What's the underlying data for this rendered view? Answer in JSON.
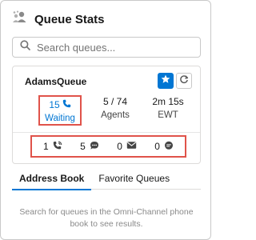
{
  "header": {
    "title": "Queue Stats",
    "icon": "people-group-icon"
  },
  "search": {
    "placeholder": "Search queues..."
  },
  "queue": {
    "name": "AdamsQueue",
    "stats": [
      {
        "value": "15",
        "label": "Waiting",
        "icon": "phone-icon"
      },
      {
        "value": "5 / 74",
        "label": "Agents"
      },
      {
        "value": "2m 15s",
        "label": "EWT"
      }
    ],
    "channels": [
      {
        "count": "1",
        "icon": "phone-call-icon"
      },
      {
        "count": "5",
        "icon": "chat-icon"
      },
      {
        "count": "0",
        "icon": "email-icon"
      },
      {
        "count": "0",
        "icon": "messaging-icon"
      }
    ]
  },
  "tabs": [
    {
      "label": "Address Book",
      "active": true
    },
    {
      "label": "Favorite Queues",
      "active": false
    }
  ],
  "empty_message": "Search for queues in the Omni-Channel phone book to see results.",
  "colors": {
    "accent": "#0176d3",
    "highlight": "#e0534a"
  }
}
